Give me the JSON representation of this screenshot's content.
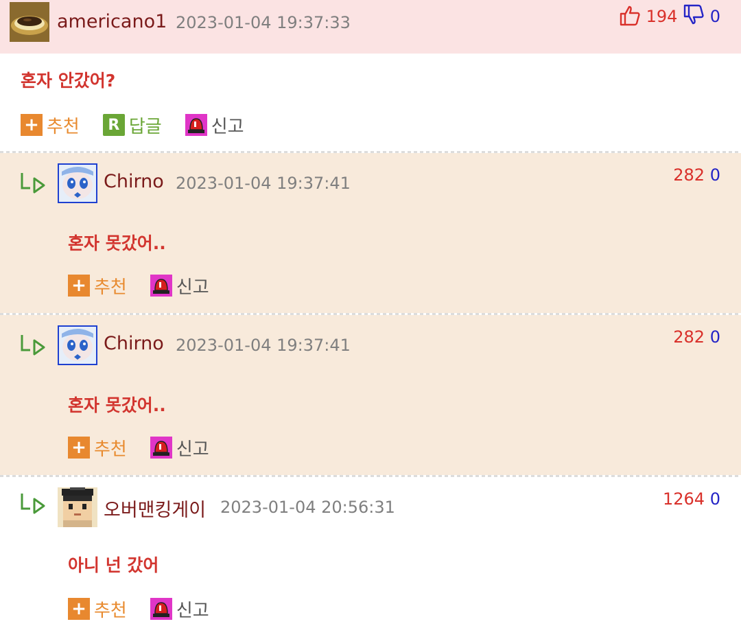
{
  "comments": [
    {
      "author": "americano1",
      "date": "2023-01-04 19:37:33",
      "text": "혼자 안갔어?",
      "score_up": "194",
      "score_down": "0",
      "avatar": "coffee-cup-avatar"
    },
    {
      "author": "Chirno",
      "date": "2023-01-04 19:37:41",
      "text": "혼자 못갔어..",
      "score_up": "282",
      "score_down": "0",
      "avatar": "anime-girl-avatar"
    },
    {
      "author": "Chirno",
      "date": "2023-01-04 19:37:41",
      "text": "혼자 못갔어..",
      "score_up": "282",
      "score_down": "0",
      "avatar": "anime-girl-avatar"
    },
    {
      "author": "오버맨킹게이",
      "date": "2023-01-04 20:56:31",
      "text": "아니 넌 갔어",
      "score_up": "1264",
      "score_down": "0",
      "avatar": "pixel-character-avatar"
    }
  ],
  "actions": {
    "recommend": "추천",
    "reply": "답글",
    "report": "신고",
    "reply_icon_letter": "R",
    "plus_icon": "+"
  },
  "colors": {
    "header_bg": "#fbe3e3",
    "reply_bg": "#f8eadb",
    "score_up": "#d9302a",
    "score_down": "#2424c6",
    "comment_text": "#d2352f",
    "author": "#7a1a1a"
  }
}
